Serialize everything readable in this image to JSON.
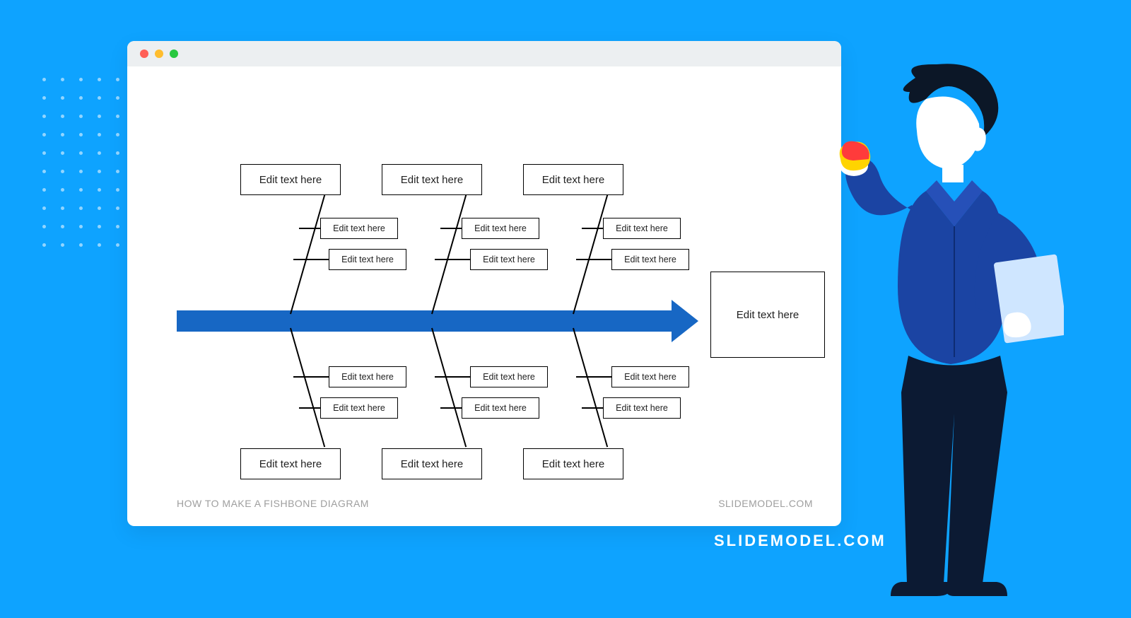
{
  "footer": {
    "left": "HOW TO MAKE A FISHBONE DIAGRAM",
    "right": "SLIDEMODEL.COM"
  },
  "brand": "SLIDEMODEL.COM",
  "diagram": {
    "head": "Edit text here",
    "top_categories": [
      "Edit text here",
      "Edit text here",
      "Edit text here"
    ],
    "bottom_categories": [
      "Edit text here",
      "Edit text here",
      "Edit text here"
    ],
    "top_causes": [
      [
        "Edit text here",
        "Edit text here"
      ],
      [
        "Edit text here",
        "Edit text here"
      ],
      [
        "Edit text here",
        "Edit text here"
      ]
    ],
    "bottom_causes": [
      [
        "Edit text here",
        "Edit text here"
      ],
      [
        "Edit text here",
        "Edit text here"
      ],
      [
        "Edit text here",
        "Edit text here"
      ]
    ]
  }
}
